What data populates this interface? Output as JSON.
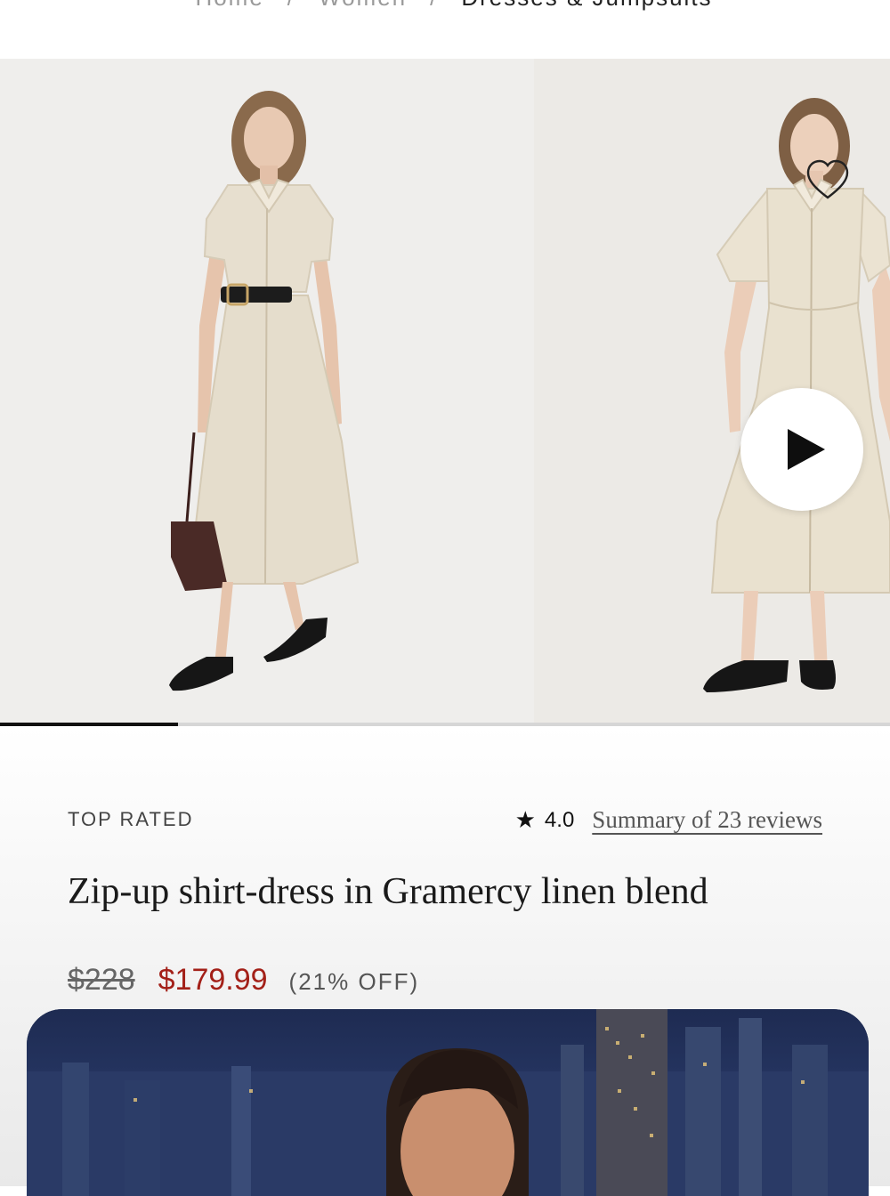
{
  "breadcrumb": {
    "items": [
      "Home",
      "Women",
      "Dresses & Jumpsuits"
    ],
    "separator": "/"
  },
  "gallery": {
    "slide_count": 5,
    "current_slide": 1,
    "progress_fraction": 0.2,
    "icons": {
      "favorite": "heart-icon",
      "video": "play-icon"
    }
  },
  "product": {
    "badge": "TOP RATED",
    "rating": "4.0",
    "star_glyph": "★",
    "reviews_link": "Summary of 23 reviews",
    "title": "Zip-up shirt-dress in Gramercy linen blend",
    "price_original": "$228",
    "price_sale": "$179.99",
    "discount": "(21% OFF)"
  },
  "colors": {
    "sale_price": "#a32018",
    "text_primary": "#1a1a1a",
    "text_muted": "#9a9a9a"
  }
}
